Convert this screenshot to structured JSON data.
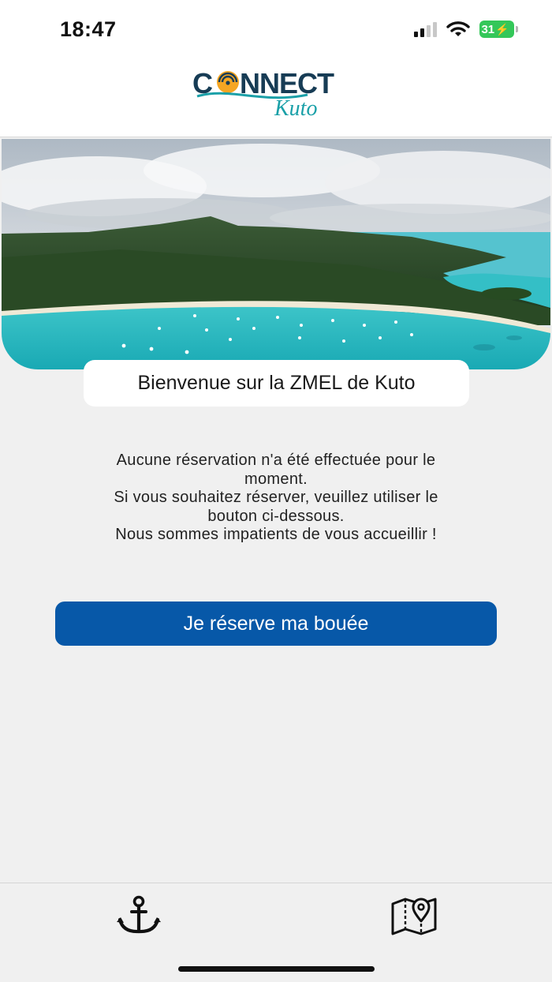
{
  "status_bar": {
    "time": "18:47",
    "battery": "31"
  },
  "header": {
    "logo_text": "CONNECT",
    "logo_subtext": "Kuto"
  },
  "hero": {
    "image": "aerial-bay-icon"
  },
  "welcome": {
    "title": "Bienvenue sur la ZMEL de Kuto"
  },
  "message": {
    "line1": "Aucune réservation n'a été effectuée pour le",
    "line2": "moment.",
    "line3": "Si vous souhaitez réserver, veuillez utiliser le",
    "line4": "bouton ci-dessous.",
    "line5": "Nous sommes impatients de vous accueillir !"
  },
  "actions": {
    "reserve_label": "Je réserve ma bouée"
  },
  "tab_bar": {
    "tabs": [
      {
        "icon": "anchor-icon"
      },
      {
        "icon": "map-pin-icon"
      }
    ]
  },
  "colors": {
    "primary_button": "#0758a8",
    "logo_dark": "#173c55",
    "logo_accent": "#f5a623",
    "logo_teal": "#1aa0a8",
    "background": "#f0f0f0",
    "battery": "#34c759"
  }
}
